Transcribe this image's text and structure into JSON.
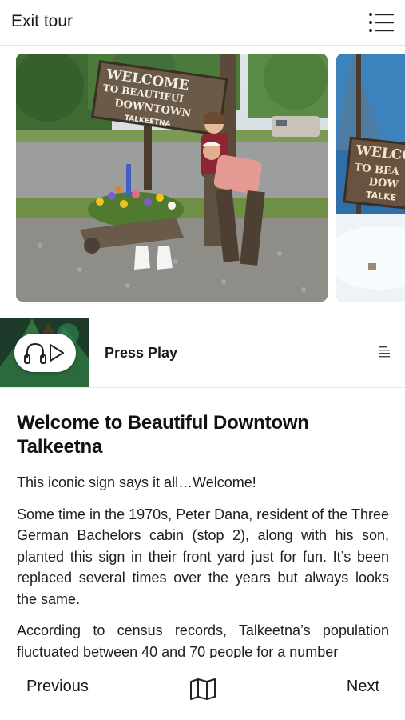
{
  "header": {
    "exit_label": "Exit tour",
    "menu_icon": "menu-list-icon"
  },
  "carousel": {
    "slides": [
      {
        "sign_lines": [
          "WELCOME",
          "TO BEAUTIFUL",
          "DOWNTOWN",
          "TALKEETNA"
        ]
      },
      {
        "sign_lines": [
          "WELCO",
          "TO BEA",
          "DOW",
          "TALKE"
        ]
      }
    ]
  },
  "player": {
    "title": "Press Play",
    "play_icon": "headphones-play-icon",
    "transcript_icon": "transcript-lines-icon"
  },
  "article": {
    "title": "Welcome to Beautiful Downtown Talkeetna",
    "paragraphs": [
      "This iconic sign says it all…Welcome!",
      "Some time in the 1970s, Peter Dana, resident of the Three German Bachelors cabin (stop 2), along with his son, planted this sign in their front yard just for fun. It’s been replaced several times over the years but always looks the same.",
      "According to census records, Talkeetna’s population fluctuated between 40 and 70 people for a number"
    ]
  },
  "footer": {
    "previous_label": "Previous",
    "next_label": "Next",
    "map_icon": "map-icon"
  }
}
